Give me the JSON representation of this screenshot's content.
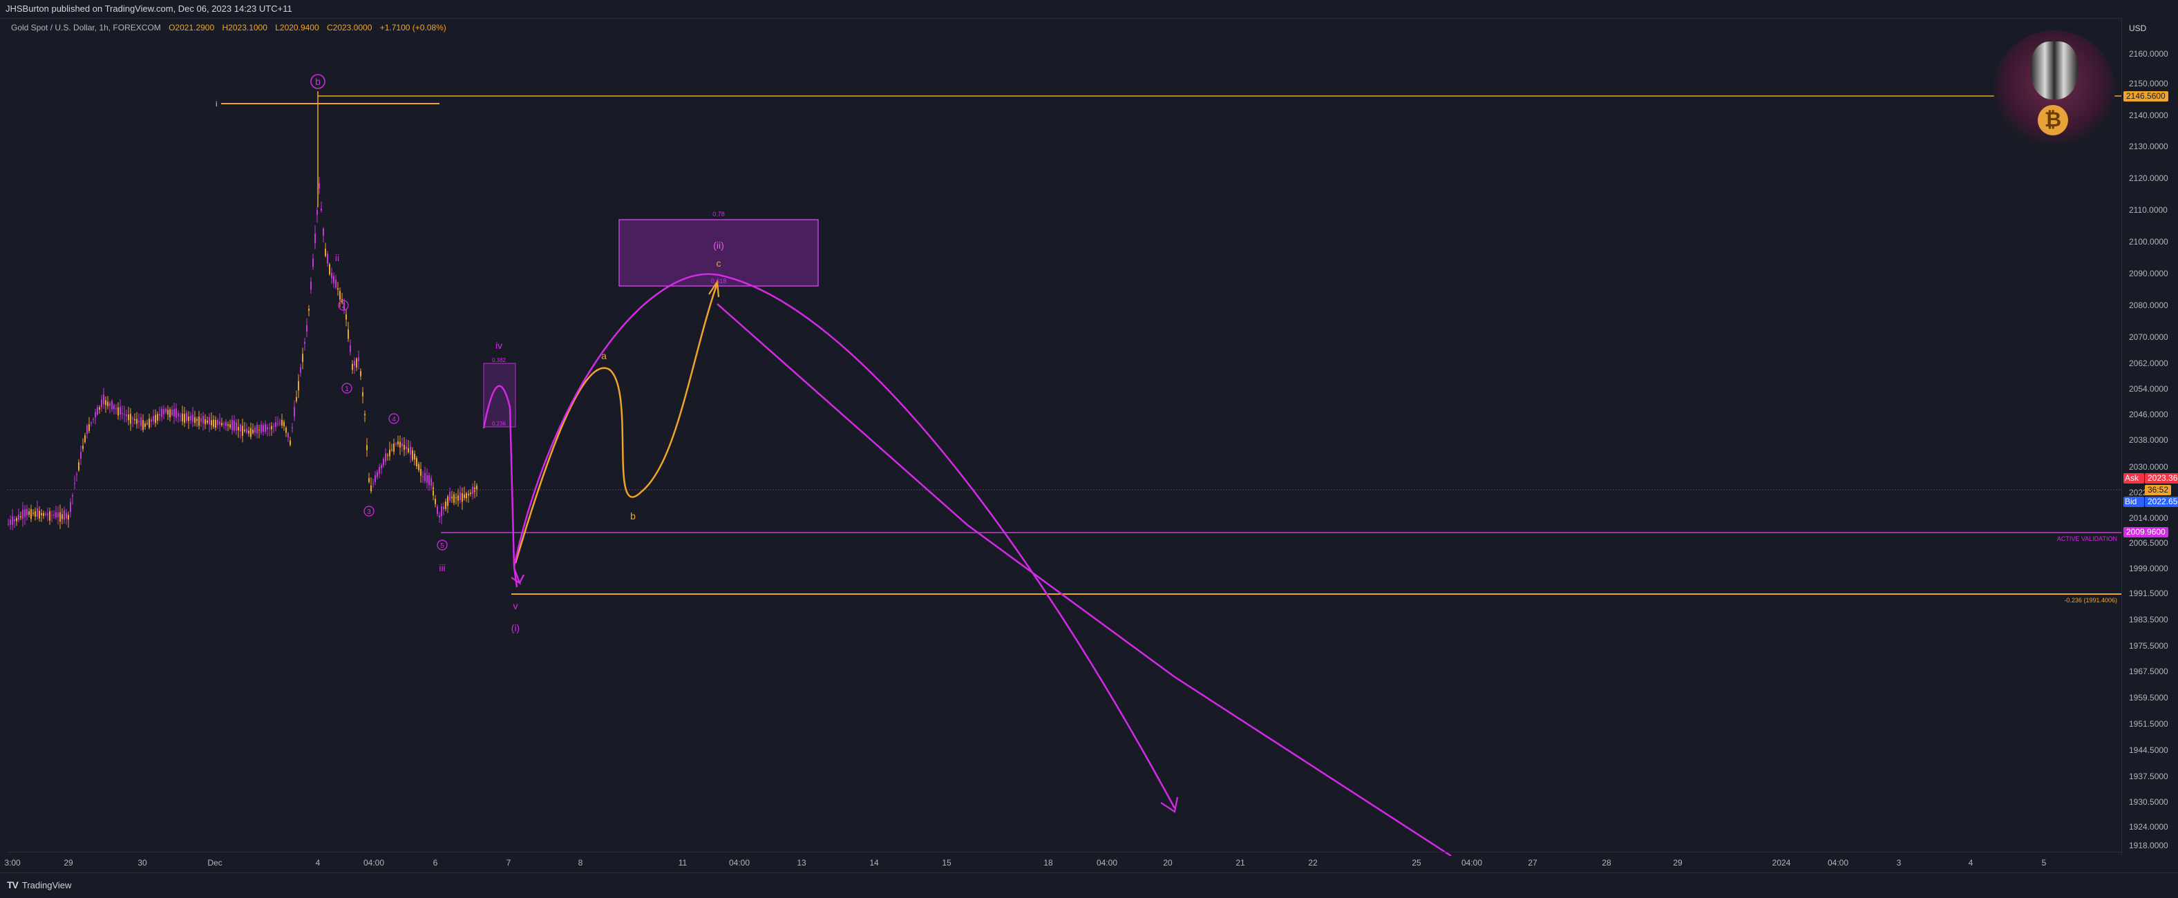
{
  "header": {
    "publish_line": "JHSBurton published on TradingView.com, Dec 06, 2023 14:23 UTC+11"
  },
  "legend": {
    "symbol": "Gold Spot / U.S. Dollar, 1h, FOREXCOM",
    "open": "O2021.2900",
    "high": "H2023.1000",
    "low": "L2020.9400",
    "close": "C2023.0000",
    "change": "+1.7100 (+0.08%)"
  },
  "price_axis": {
    "currency": "USD",
    "ticks": [
      "2160.0000",
      "2150.0000",
      "2140.0000",
      "2130.0000",
      "2120.0000",
      "2110.0000",
      "2100.0000",
      "2090.0000",
      "2080.0000",
      "2070.0000",
      "2062.0000",
      "2054.0000",
      "2046.0000",
      "2038.0000",
      "2030.0000",
      "2022.0000",
      "2014.0000",
      "2006.5000",
      "1999.0000",
      "1991.5000",
      "1983.5000",
      "1975.5000",
      "1967.5000",
      "1959.5000",
      "1951.5000",
      "1944.5000",
      "1937.5000",
      "1930.5000",
      "1924.0000",
      "1918.0000"
    ],
    "tags": {
      "top_level": "2146.5600",
      "ask_label": "Ask",
      "ask_value": "2023.3600",
      "countdown": "36:52",
      "bid_label": "Bid",
      "bid_value": "2022.6500",
      "active_level": "2009.9600"
    }
  },
  "time_axis": {
    "labels": [
      "3:00",
      "29",
      "30",
      "Dec",
      "4",
      "04:00",
      "6",
      "7",
      "8",
      "11",
      "04:00",
      "13",
      "14",
      "15",
      "18",
      "04:00",
      "20",
      "21",
      "22",
      "25",
      "04:00",
      "27",
      "28",
      "29",
      "2024",
      "04:00",
      "3",
      "4",
      "5"
    ]
  },
  "annotations": {
    "wave_b_circle": "b",
    "level_i_marker": "i",
    "wave_ii": "ii",
    "circle_2": "2",
    "circle_1": "1",
    "circle_4": "4",
    "circle_3": "3",
    "circle_5": "5",
    "wave_iii": "iii",
    "wave_iv": "iv",
    "fib_0382": "0.382",
    "fib_0236": "0.236",
    "wave_v": "v",
    "wave_i_paren": "(i)",
    "wave_a": "a",
    "wave_b": "b",
    "wave_c": "c",
    "wave_ii_paren": "(ii)",
    "fib_078": "0.78",
    "fib_0618": "0.618",
    "active_validation": "ACTIVE VALIDATION",
    "ext_level": "-0.236 (1991.4006)"
  },
  "footer": {
    "brand": "TradingView"
  },
  "colors": {
    "background": "#181b25",
    "candle": "#f0a52a",
    "magenta": "#d42ae8",
    "orange": "#f0a52a",
    "ask": "#f23645",
    "bid": "#2962ff"
  }
}
